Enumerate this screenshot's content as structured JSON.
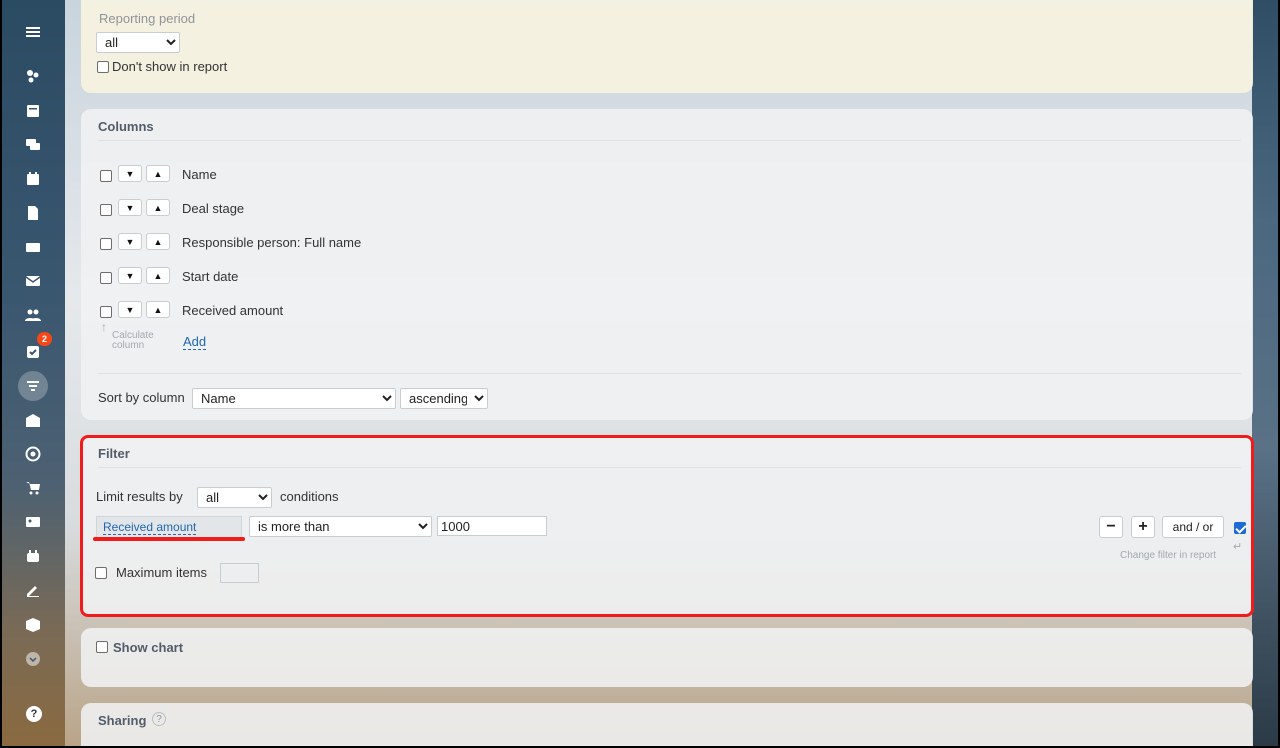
{
  "sidebar": {
    "icons": [
      "menu-icon",
      "widgets-icon",
      "feed-icon",
      "chat-icon",
      "calendar-icon",
      "documents-icon",
      "drive-icon",
      "mail-icon",
      "groups-icon",
      "tasks-icon",
      "crm-icon",
      "company-icon",
      "target-icon",
      "shop-icon",
      "contact-center-icon",
      "robot-icon",
      "sign-icon",
      "box-icon",
      "more-icon"
    ],
    "tasks_badge": "2",
    "help_glyph": "?"
  },
  "period": {
    "label": "Reporting period",
    "value": "all",
    "dont_show_label": "Don't show in report"
  },
  "columns": {
    "title": "Columns",
    "rows": [
      {
        "label": "Name"
      },
      {
        "label": "Deal stage"
      },
      {
        "label": "Responsible person: Full name"
      },
      {
        "label": "Start date"
      },
      {
        "label": "Received amount"
      }
    ],
    "calc_hint": "Calculate column",
    "add_label": "Add",
    "sort_label": "Sort by column",
    "sort_value": "Name",
    "sort_order": "ascending"
  },
  "filter": {
    "title": "Filter",
    "limit_label": "Limit results by",
    "limit_value": "all",
    "conditions_label": "conditions",
    "field_link": "Received amount",
    "operator": "is more than",
    "value": "1000",
    "minus_label": "−",
    "plus_label": "+",
    "andor_label": "and / or",
    "change_hint": "Change filter in report",
    "max_items_label": "Maximum items",
    "max_items_value": ""
  },
  "chart": {
    "show_chart_label": "Show chart"
  },
  "sharing": {
    "title": "Sharing",
    "help_glyph": "?"
  },
  "colors": {
    "highlight": "#f01c1c",
    "accent": "#1d6ad8",
    "link": "#2067b0"
  }
}
